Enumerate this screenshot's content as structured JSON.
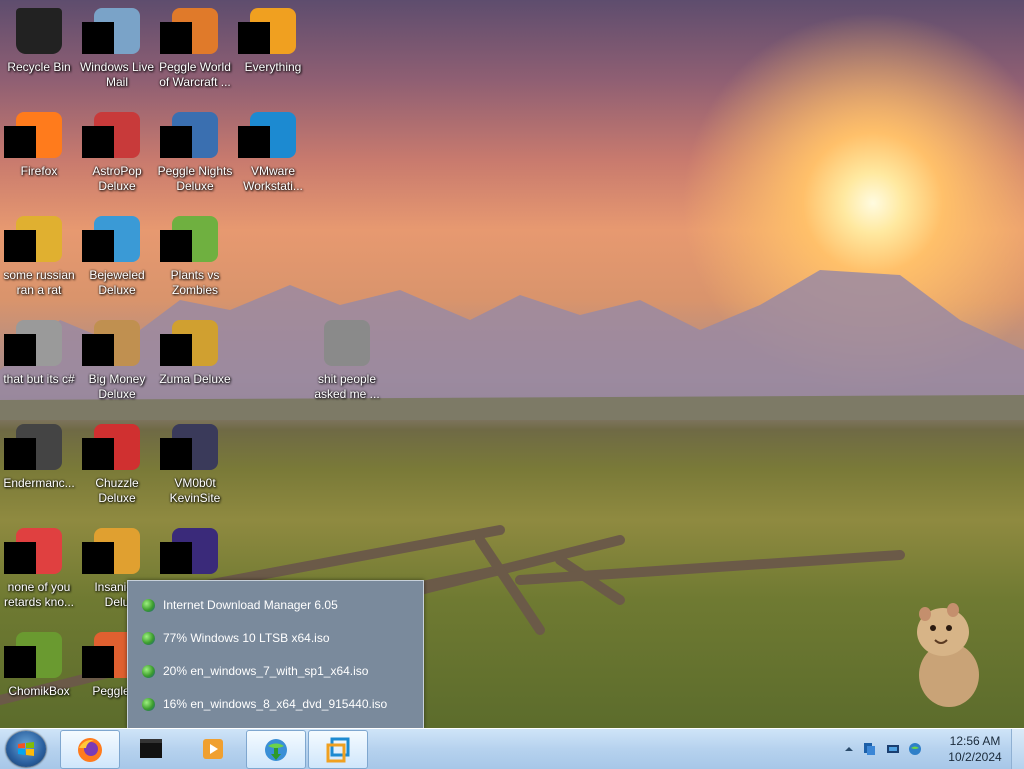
{
  "desktop": {
    "icons": [
      {
        "id": "recycle-bin",
        "label": "Recycle Bin",
        "masked": false
      },
      {
        "id": "windows-live-mail",
        "label": "Windows Live\nMail",
        "masked": true
      },
      {
        "id": "peggle-world-of-warcraft",
        "label": "Peggle World\nof Warcraft ...",
        "masked": true
      },
      {
        "id": "everything",
        "label": "Everything",
        "masked": true
      },
      {
        "id": "firefox",
        "label": "Firefox",
        "masked": true
      },
      {
        "id": "astropop-deluxe",
        "label": "AstroPop\nDeluxe",
        "masked": true
      },
      {
        "id": "peggle-nights-deluxe",
        "label": "Peggle Nights\nDeluxe",
        "masked": true
      },
      {
        "id": "vmware-workstation",
        "label": "VMware\nWorkstati...",
        "masked": true
      },
      {
        "id": "some-russian-ran-a-rat",
        "label": "some russian\nran a rat",
        "masked": true
      },
      {
        "id": "bejeweled-deluxe",
        "label": "Bejeweled\nDeluxe",
        "masked": true
      },
      {
        "id": "plants-vs-zombies",
        "label": "Plants vs\nZombies",
        "masked": true
      },
      {
        "id": "that-but-its-csharp",
        "label": "that but its c#",
        "masked": true
      },
      {
        "id": "big-money-deluxe",
        "label": "Big Money\nDeluxe",
        "masked": true
      },
      {
        "id": "zuma-deluxe",
        "label": "Zuma Deluxe",
        "masked": true
      },
      {
        "id": "shit-people-asked-me",
        "label": "shit people\nasked me ...",
        "masked": false
      },
      {
        "id": "endermanch",
        "label": "Endermanc...",
        "masked": true
      },
      {
        "id": "chuzzle-deluxe",
        "label": "Chuzzle\nDeluxe",
        "masked": true
      },
      {
        "id": "vm0b0t-kevinsite",
        "label": "VM0b0t\nKevinSite",
        "masked": true
      },
      {
        "id": "none-of-you-retards",
        "label": "none of you\nretards kno...",
        "masked": true
      },
      {
        "id": "insaniquarium-deluxe",
        "label": "Insaniqu\nDelu",
        "masked": true
      },
      {
        "id": "unknown-purple",
        "label": "",
        "masked": true
      },
      {
        "id": "chomikbox",
        "label": "ChomikBox",
        "masked": true
      },
      {
        "id": "peggle-deluxe",
        "label": "Peggle D",
        "masked": true
      }
    ]
  },
  "idm_popup": {
    "items": [
      {
        "label": "Internet Download Manager 6.05"
      },
      {
        "label": "77% Windows 10 LTSB x64.iso"
      },
      {
        "label": "20% en_windows_7_with_sp1_x64.iso"
      },
      {
        "label": "16% en_windows_8_x64_dvd_915440.iso"
      }
    ]
  },
  "taskbar": {
    "buttons": [
      {
        "id": "firefox",
        "icon": "firefox-icon"
      },
      {
        "id": "terminal",
        "icon": "cmd-icon"
      },
      {
        "id": "media-player",
        "icon": "media-player-icon"
      },
      {
        "id": "internet-download-manager",
        "icon": "idm-icon",
        "active": true
      },
      {
        "id": "vmware",
        "icon": "vmware-icon"
      }
    ],
    "clock": {
      "time": "12:56 AM",
      "date": "10/2/2024"
    }
  }
}
